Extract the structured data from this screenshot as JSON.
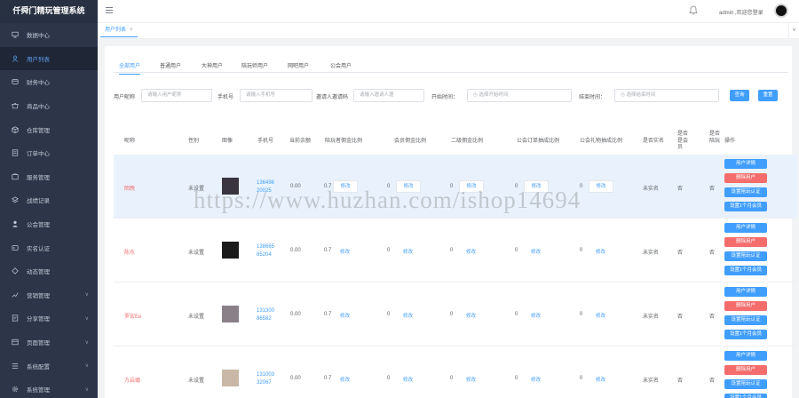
{
  "app": {
    "title": "仟舜门精玩管理系统"
  },
  "sidebar": {
    "items": [
      {
        "label": "数据中心",
        "icon": "monitor-icon",
        "chevron": false
      },
      {
        "label": "用户列表",
        "icon": "user-icon",
        "chevron": false,
        "active": true
      },
      {
        "label": "财务中心",
        "icon": "finance-icon",
        "chevron": false
      },
      {
        "label": "商品中心",
        "icon": "shop-icon",
        "chevron": false
      },
      {
        "label": "仓库管理",
        "icon": "box-icon",
        "chevron": false
      },
      {
        "label": "订单中心",
        "icon": "order-icon",
        "chevron": false
      },
      {
        "label": "服务管理",
        "icon": "service-icon",
        "chevron": false
      },
      {
        "label": "战绩记录",
        "icon": "layers-icon",
        "chevron": false
      },
      {
        "label": "公会管理",
        "icon": "guild-icon",
        "chevron": false
      },
      {
        "label": "实名认证",
        "icon": "card-icon",
        "chevron": false
      },
      {
        "label": "动态管理",
        "icon": "dynamic-icon",
        "chevron": false
      },
      {
        "label": "营销管理",
        "icon": "marketing-icon",
        "chevron": true
      },
      {
        "label": "分享管理",
        "icon": "share-icon",
        "chevron": true
      },
      {
        "label": "页面管理",
        "icon": "page-icon",
        "chevron": true
      },
      {
        "label": "系统配置",
        "icon": "list-icon",
        "chevron": true
      },
      {
        "label": "系统管理",
        "icon": "gear-icon",
        "chevron": true
      }
    ]
  },
  "header": {
    "welcome": "admin ,欢迎您登录"
  },
  "tabs": {
    "current": "用户列表",
    "close": "×",
    "scroll": "∨"
  },
  "filters": {
    "tabs": [
      "全部用户",
      "普通用户",
      "大神用户",
      "陪玩师用户",
      "网吧用户",
      "公会用户"
    ]
  },
  "search": {
    "nickname_label": "用户昵称",
    "nickname_placeholder": "请输入用户昵称",
    "phone_label": "手机号",
    "phone_placeholder": "请输入手机号",
    "invite_label": "邀请人邀请码",
    "invite_placeholder": "请输入邀请人邀",
    "start_label": "开始时间：",
    "start_placeholder": "选择开始时间",
    "end_label": "结束时间：",
    "end_placeholder": "选择结束时间",
    "query_btn": "查询",
    "reset_btn": "重置"
  },
  "table": {
    "headers": [
      "昵称",
      "性别",
      "图像",
      "手机号",
      "当前余额",
      "陪玩者佣金比例",
      "会员佣金比例",
      "二级佣金比例",
      "公会订单抽成比例",
      "公会礼物抽成比例",
      "是否实名",
      "是否是会员",
      "是否陪玩",
      "操作"
    ],
    "edit_label": "修改",
    "actions": [
      "用户详情",
      "删除用户",
      "设置陪玩认证",
      "设置1个月会员"
    ],
    "rows": [
      {
        "nickname": "陌晚",
        "gender": "未设置",
        "phone": "13649620025",
        "balance": "0.00",
        "ratio": "0.7",
        "zero": "0",
        "realname": "未实名",
        "member": "否",
        "peiwan": "否",
        "thumb": "#3a3340"
      },
      {
        "nickname": "陈东",
        "gender": "未设置",
        "phone": "13866585204",
        "balance": "0.00",
        "ratio": "0.7",
        "zero": "0",
        "realname": "未实名",
        "member": "否",
        "peiwan": "否",
        "thumb": "#1a1a1a"
      },
      {
        "nickname": "罗宏Ee",
        "gender": "未设置",
        "phone": "13130086582",
        "balance": "0.00",
        "ratio": "0.7",
        "zero": "0",
        "realname": "未实名",
        "member": "否",
        "peiwan": "否",
        "thumb": "#8a8088"
      },
      {
        "nickname": "方启璐",
        "gender": "未设置",
        "phone": "13100332067",
        "balance": "0.00",
        "ratio": "0.7",
        "zero": "0",
        "realname": "未实名",
        "member": "否",
        "peiwan": "否",
        "thumb": "#c9b8a8"
      }
    ]
  },
  "watermark": "https://www.huzhan.com/ishop14694"
}
